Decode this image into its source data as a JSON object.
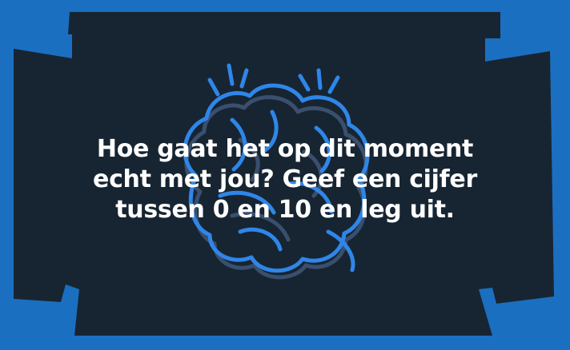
{
  "card": {
    "question": "Hoe gaat het op dit moment echt met jou? Geef een cijfer tussen 0 en 10 en leg uit.",
    "decoration_icon": "brain-icon",
    "colors": {
      "background": "#1b6fc0",
      "panel": "#172532",
      "text": "#ffffff",
      "illustration_primary": "#2f86e8",
      "illustration_shadow": "#3a4f6e"
    }
  }
}
